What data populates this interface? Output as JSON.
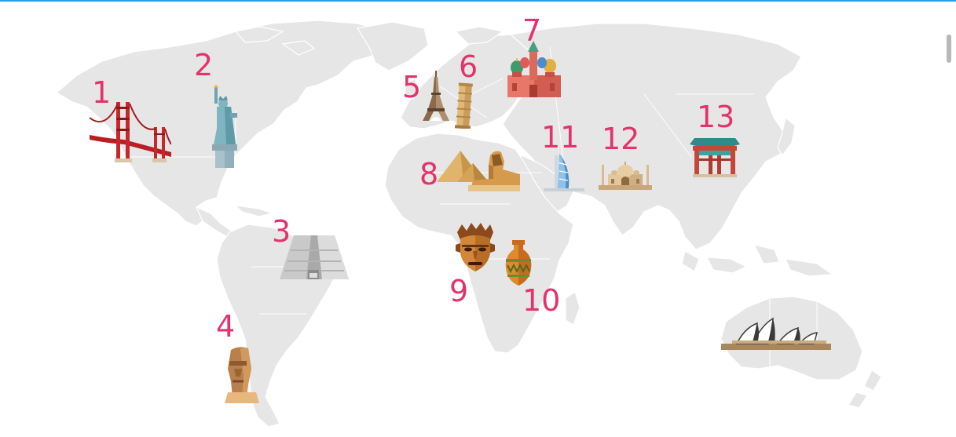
{
  "markers": [
    {
      "number": "1",
      "icon": "golden-gate-bridge-icon"
    },
    {
      "number": "2",
      "icon": "statue-of-liberty-icon"
    },
    {
      "number": "3",
      "icon": "chichen-itza-pyramid-icon"
    },
    {
      "number": "4",
      "icon": "moai-statue-icon"
    },
    {
      "number": "5",
      "icon": "eiffel-tower-icon"
    },
    {
      "number": "6",
      "icon": "leaning-tower-of-pisa-icon"
    },
    {
      "number": "7",
      "icon": "st-basils-cathedral-icon"
    },
    {
      "number": "8",
      "icon": "pyramids-and-sphinx-icon"
    },
    {
      "number": "9",
      "icon": "african-mask-icon"
    },
    {
      "number": "10",
      "icon": "african-vase-icon"
    },
    {
      "number": "11",
      "icon": "burj-al-arab-icon"
    },
    {
      "number": "12",
      "icon": "taj-mahal-icon"
    },
    {
      "number": "13",
      "icon": "chinese-gate-icon"
    }
  ],
  "unnumbered_landmarks": [
    {
      "icon": "sydney-opera-house-icon"
    }
  ],
  "colors": {
    "land": "#e6e6e6",
    "numbers": "#e2336b",
    "top_bar": "#2aa0e6"
  }
}
